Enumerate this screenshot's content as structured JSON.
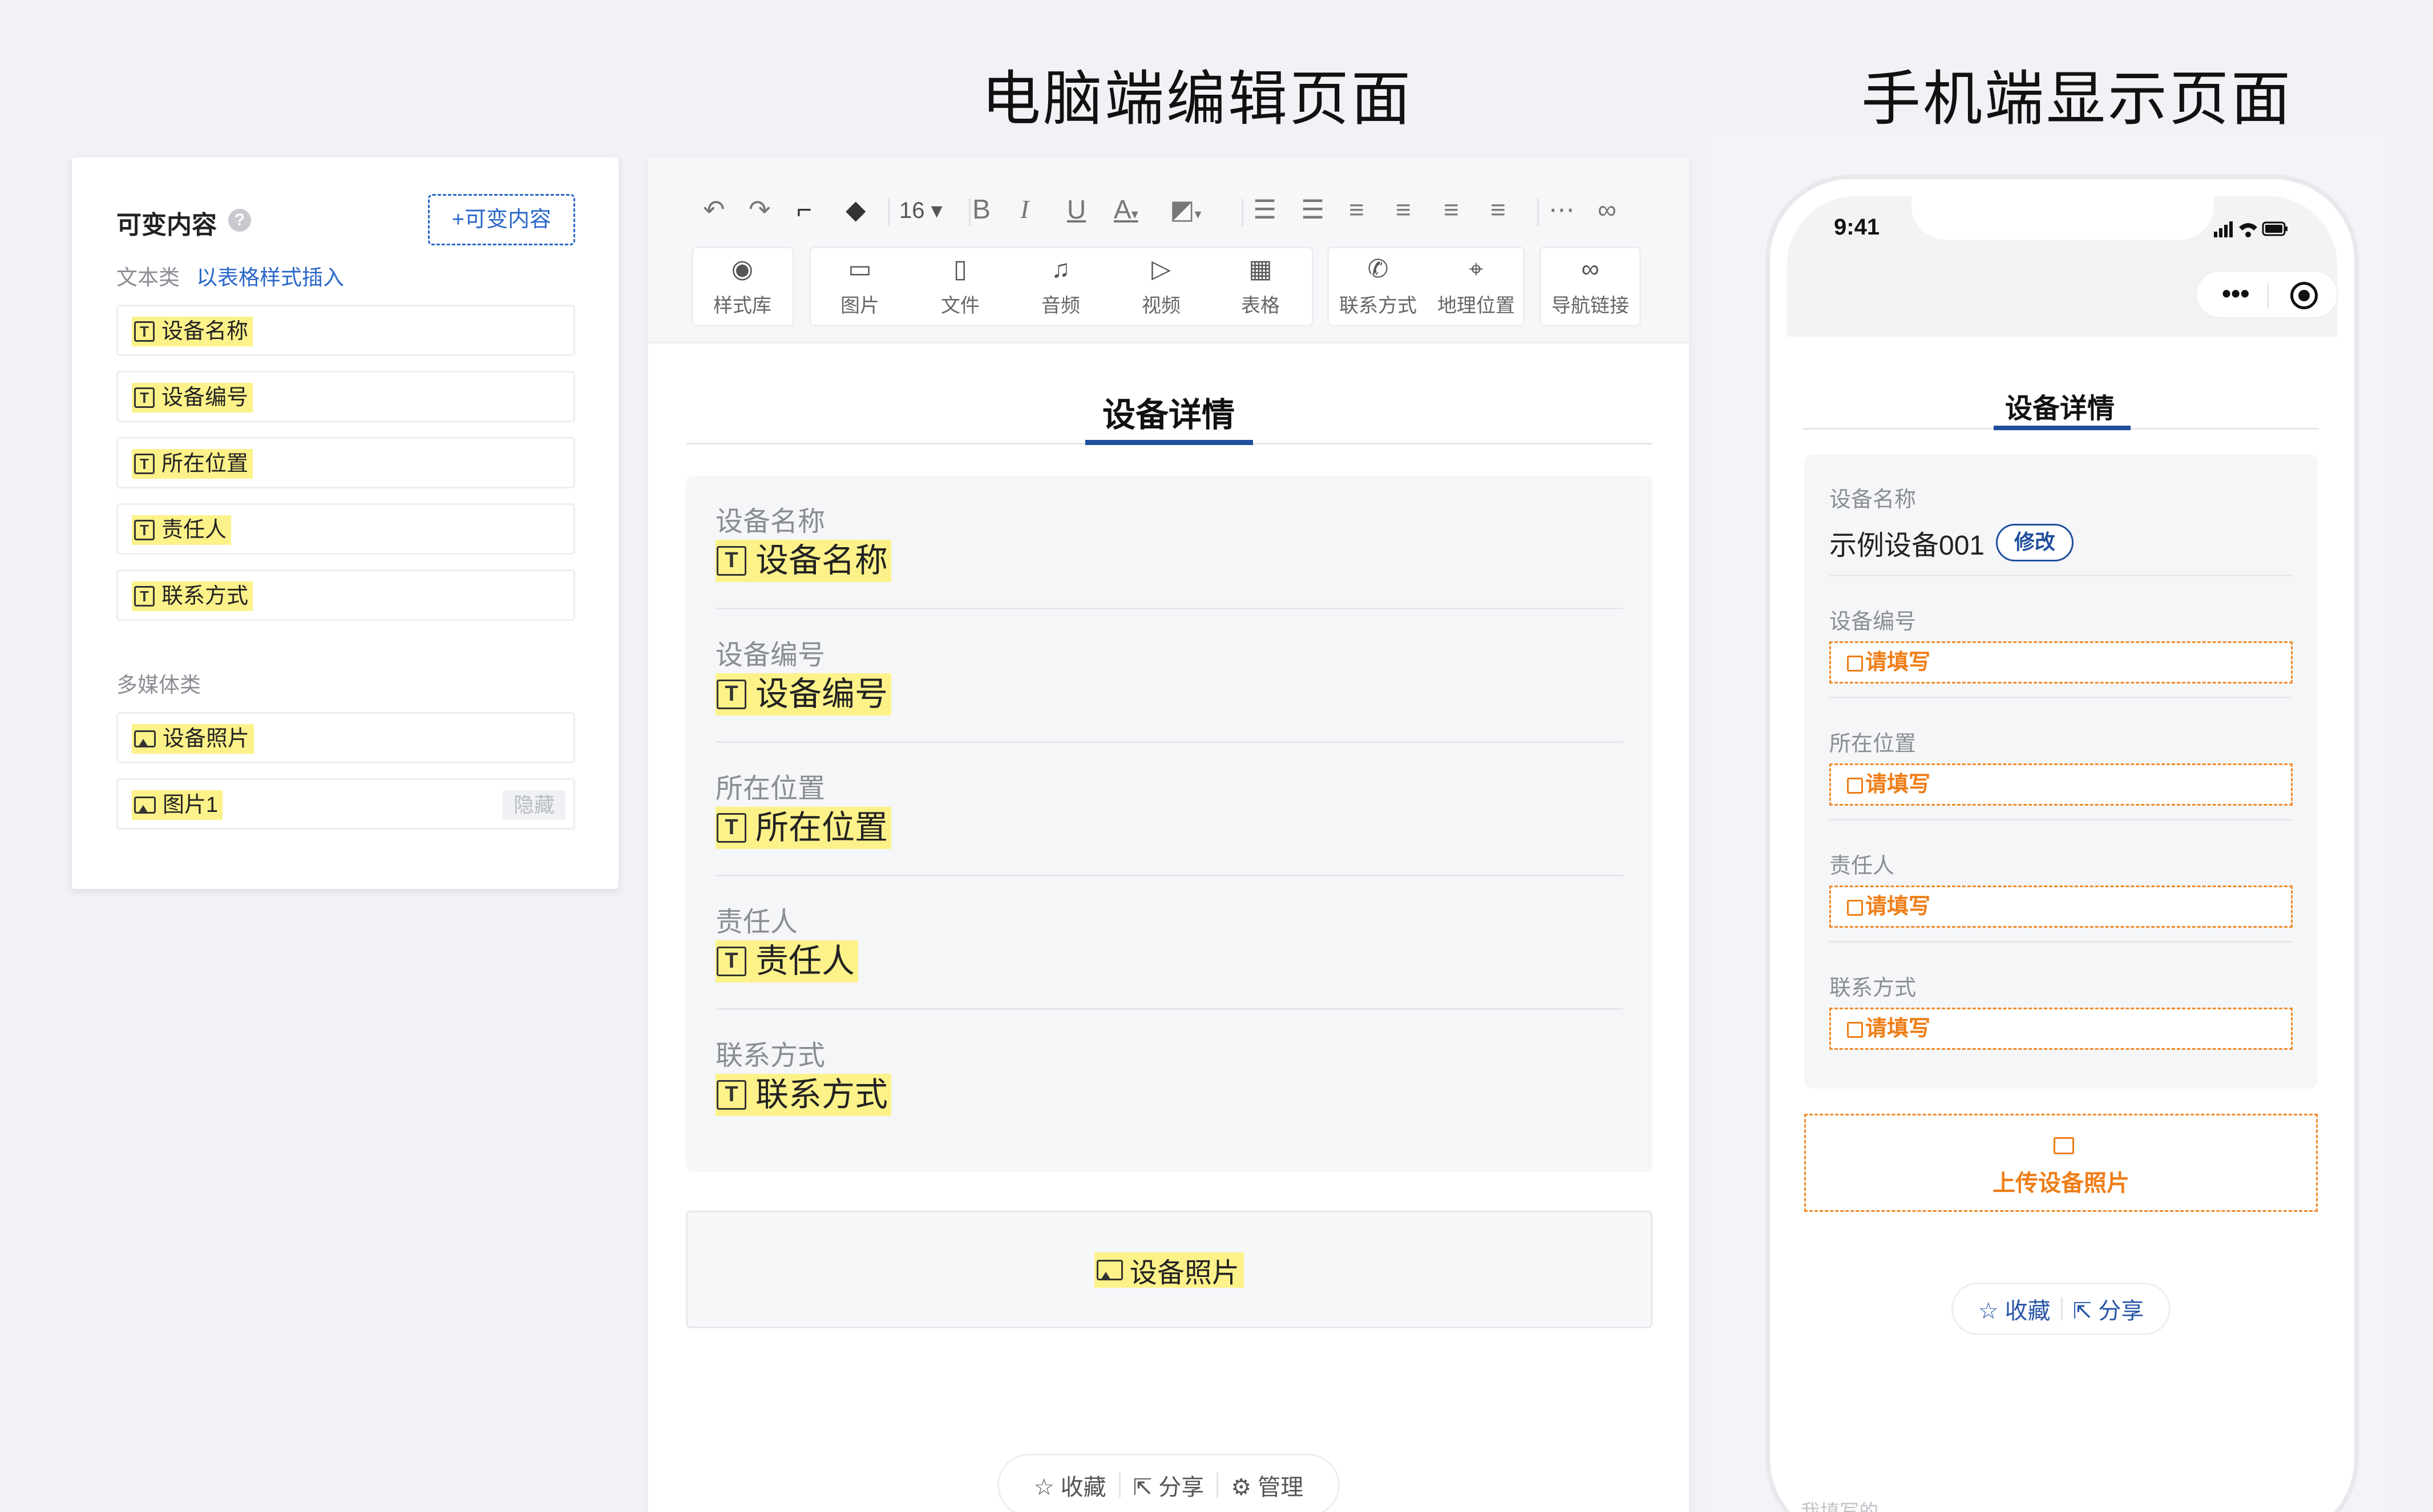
{
  "headings": {
    "editor": "电脑端编辑页面",
    "mobile": "手机端显示页面"
  },
  "left_panel": {
    "title": "可变内容",
    "help_icon": "?",
    "add_button": "+可变内容",
    "text_category": "文本类",
    "insert_link": "以表格样式插入",
    "text_items": [
      {
        "label": "设备名称",
        "icon": "T"
      },
      {
        "label": "设备编号",
        "icon": "T"
      },
      {
        "label": "所在位置",
        "icon": "T"
      },
      {
        "label": "责任人",
        "icon": "T"
      },
      {
        "label": "联系方式",
        "icon": "T"
      }
    ],
    "media_category": "多媒体类",
    "media_items": [
      {
        "label": "设备照片",
        "icon": "image-icon",
        "tag": ""
      },
      {
        "label": "图片1",
        "icon": "image-icon",
        "tag": "隐藏"
      }
    ]
  },
  "toolbar": {
    "font_size": "16",
    "format_icons": [
      "undo-icon",
      "redo-icon",
      "format-painter-icon",
      "eraser-icon",
      "bold-icon",
      "italic-icon",
      "underline-icon",
      "font-color-icon",
      "highlight-icon",
      "ordered-list-icon",
      "unordered-list-icon",
      "align-left-icon",
      "align-center-icon",
      "align-right-icon",
      "justify-icon",
      "divider-icon",
      "link-icon"
    ],
    "buttons": [
      {
        "label": "样式库",
        "icon": "palette-icon"
      },
      {
        "label": "图片",
        "icon": "image-icon"
      },
      {
        "label": "文件",
        "icon": "file-icon"
      },
      {
        "label": "音频",
        "icon": "music-icon"
      },
      {
        "label": "视频",
        "icon": "video-icon"
      },
      {
        "label": "表格",
        "icon": "table-icon"
      },
      {
        "label": "联系方式",
        "icon": "phone-icon"
      },
      {
        "label": "地理位置",
        "icon": "location-icon"
      },
      {
        "label": "导航链接",
        "icon": "link-icon"
      }
    ]
  },
  "editor_doc": {
    "title": "设备详情",
    "fields": [
      {
        "label": "设备名称",
        "value": "设备名称"
      },
      {
        "label": "设备编号",
        "value": "设备编号"
      },
      {
        "label": "所在位置",
        "value": "所在位置"
      },
      {
        "label": "责任人",
        "value": "责任人"
      },
      {
        "label": "联系方式",
        "value": "联系方式"
      }
    ],
    "photo_label": "设备照片",
    "bottom_actions": [
      "收藏",
      "分享",
      "管理"
    ]
  },
  "phone": {
    "time": "9:41",
    "title": "设备详情",
    "fields": [
      {
        "label": "设备名称",
        "value": "示例设备001",
        "edit": "修改"
      },
      {
        "label": "设备编号",
        "placeholder": "请填写"
      },
      {
        "label": "所在位置",
        "placeholder": "请填写"
      },
      {
        "label": "责任人",
        "placeholder": "请填写"
      },
      {
        "label": "联系方式",
        "placeholder": "请填写"
      }
    ],
    "upload_label": "上传设备照片",
    "actions": [
      "收藏",
      "分享"
    ],
    "footer_text": "我填写的"
  },
  "colors": {
    "accent_blue": "#1f4f9c",
    "link_blue": "#2a67c9",
    "variable_highlight": "#fdf28a",
    "required_orange": "#ef7d16"
  }
}
